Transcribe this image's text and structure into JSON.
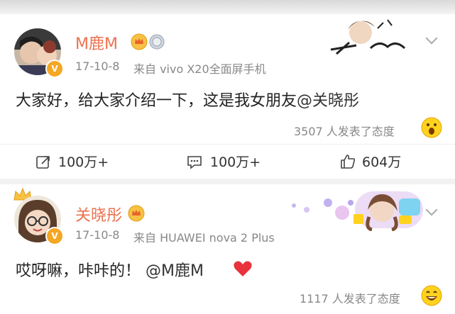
{
  "post": {
    "username": "M鹿M",
    "timestamp": "17-10-8",
    "source": "来自 vivo X20全面屏手机",
    "content": "大家好，给大家介绍一下，这是我女朋友",
    "mention": "@关晓彤",
    "reactions_text": "3507 人发表了态度"
  },
  "actions": {
    "repost_count": "100万+",
    "comment_count": "100万+",
    "like_count": "604万"
  },
  "reply": {
    "username": "关晓彤",
    "timestamp": "17-10-8",
    "source": "来自 HUAWEI nova 2 Plus",
    "content": "哎呀嘛，咔咔的！",
    "mention": "@M鹿M",
    "reactions_text": "1117 人发表了态度"
  },
  "colors": {
    "username": "#eb7350",
    "verified_badge": "#f5a623",
    "heart": "#e8333c"
  }
}
